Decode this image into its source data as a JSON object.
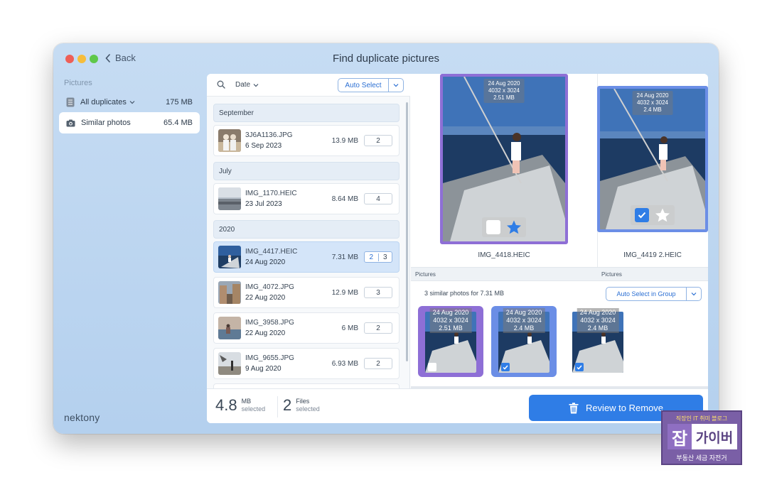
{
  "window": {
    "title": "Find duplicate pictures",
    "back_label": "Back"
  },
  "sidebar": {
    "heading": "Pictures",
    "items": [
      {
        "label": "All duplicates",
        "size": "175 MB"
      },
      {
        "label": "Similar photos",
        "size": "65.4 MB"
      }
    ],
    "brand": "nektony"
  },
  "list": {
    "sort_label": "Date",
    "auto_select_label": "Auto Select",
    "groups": [
      {
        "title": "September",
        "rows": [
          {
            "name": "3J6A1136.JPG",
            "date": "6 Sep 2023",
            "size": "13.9 MB",
            "count": "2"
          }
        ]
      },
      {
        "title": "July",
        "rows": [
          {
            "name": "IMG_1170.HEIC",
            "date": "23 Jul 2023",
            "size": "8.64 MB",
            "count": "4"
          }
        ]
      },
      {
        "title": "2020",
        "rows": [
          {
            "name": "IMG_4417.HEIC",
            "date": "24 Aug 2020",
            "size": "7.31 MB",
            "count_selected": "2",
            "count": "3"
          },
          {
            "name": "IMG_4072.JPG",
            "date": "22 Aug 2020",
            "size": "12.9 MB",
            "count": "3"
          },
          {
            "name": "IMG_3958.JPG",
            "date": "22 Aug 2020",
            "size": "6 MB",
            "count": "2"
          },
          {
            "name": "IMG_9655.JPG",
            "date": "9 Aug 2020",
            "size": "6.93 MB",
            "count": "2"
          }
        ]
      }
    ]
  },
  "detail": {
    "preview_1": {
      "meta_date": "24 Aug 2020",
      "meta_res": "4032 x 3024",
      "meta_size": "2.51 MB",
      "caption": "IMG_4418.HEIC",
      "checked": false
    },
    "preview_2": {
      "meta_date": "24 Aug 2020",
      "meta_res": "4032 x 3024",
      "meta_size": "2.4 MB",
      "caption": "IMG_4419 2.HEIC",
      "checked": true
    },
    "pictures_label_1": "Pictures",
    "pictures_label_2": "Pictures",
    "similar_info": "3 similar photos for 7.31 MB",
    "auto_select_group_label": "Auto Select in Group",
    "thumbs": [
      {
        "meta_date": "24 Aug 2020",
        "meta_res": "4032 x 3024",
        "meta_size": "2.51 MB",
        "checked": false
      },
      {
        "meta_date": "24 Aug 2020",
        "meta_res": "4032 x 3024",
        "meta_size": "2.4 MB",
        "checked": true
      },
      {
        "meta_date": "24 Aug 2020",
        "meta_res": "4032 x 3024",
        "meta_size": "2.4 MB",
        "checked": true
      }
    ]
  },
  "footer": {
    "size_value": "4.8",
    "size_unit": "MB",
    "size_sub": "selected",
    "files_value": "2",
    "files_unit": "Files",
    "files_sub": "selected",
    "review_label": "Review to Remove"
  },
  "watermark": {
    "top": "직장인 IT 취미 블로그",
    "mark": "잡",
    "name": "가이버",
    "bottom": "부동산 세금 자전거"
  },
  "colors": {
    "accent": "#2f7de6",
    "group_purple": "#8e6fd6",
    "group_blue": "#6b8ee6",
    "window_bg": "#c6dcf3"
  }
}
